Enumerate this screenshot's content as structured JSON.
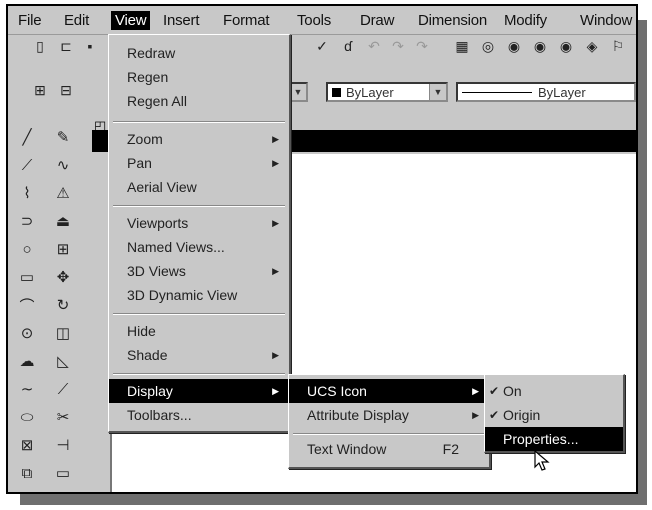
{
  "menubar": [
    "File",
    "Edit",
    "View",
    "Insert",
    "Format",
    "Tools",
    "Draw",
    "Dimension",
    "Modify",
    "Window"
  ],
  "layer_combo": "ByLayer",
  "linetype_combo": "ByLayer",
  "view_menu": {
    "items": [
      "Redraw",
      "Regen",
      "Regen All",
      "Zoom",
      "Pan",
      "Aerial View",
      "Viewports",
      "Named Views...",
      "3D Views",
      "3D Dynamic View",
      "Hide",
      "Shade",
      "Display",
      "Toolbars..."
    ]
  },
  "display_menu": {
    "items": [
      "UCS Icon",
      "Attribute Display",
      "Text Window"
    ],
    "text_window_shortcut": "F2"
  },
  "ucs_menu": {
    "items": [
      "On",
      "Origin",
      "Properties..."
    ]
  },
  "icons": {
    "submenu_arrow": "▶",
    "checkmark": "✔",
    "dropdown": "▼"
  },
  "colors": {
    "menu_bg": "#c8c8c8",
    "highlight": "#000000",
    "canvas": "#ffffff"
  }
}
